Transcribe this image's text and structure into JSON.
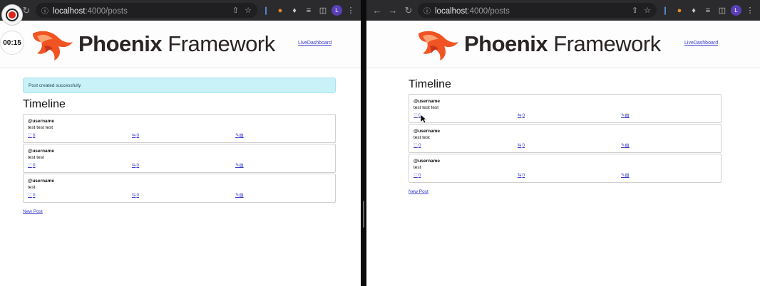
{
  "browser": {
    "url_host": "localhost",
    "url_rest": ":4000/posts",
    "profile_initial": "L"
  },
  "recorder": {
    "timer": "00:15"
  },
  "header": {
    "logo_bold": "Phoenix",
    "logo_light": "Framework",
    "dashboard_link": "LiveDashboard"
  },
  "colors": {
    "link": "#3b3bcc",
    "flash_bg": "#c9f1f8",
    "logo_orange": "#f05423"
  },
  "left": {
    "flash": "Post created successfully",
    "heading": "Timeline",
    "posts": [
      {
        "username": "@username",
        "body": "test test test",
        "likes": "0",
        "reposts": "0"
      },
      {
        "username": "@username",
        "body": "test test",
        "likes": "0",
        "reposts": "0"
      },
      {
        "username": "@username",
        "body": "test",
        "likes": "0",
        "reposts": "0"
      }
    ],
    "new_post": "New Post"
  },
  "right": {
    "heading": "Timeline",
    "posts": [
      {
        "username": "@username",
        "body": "test test test",
        "likes": "0",
        "reposts": "0"
      },
      {
        "username": "@username",
        "body": "test test",
        "likes": "0",
        "reposts": "0"
      },
      {
        "username": "@username",
        "body": "test",
        "likes": "0",
        "reposts": "0"
      }
    ],
    "new_post": "New Post"
  }
}
